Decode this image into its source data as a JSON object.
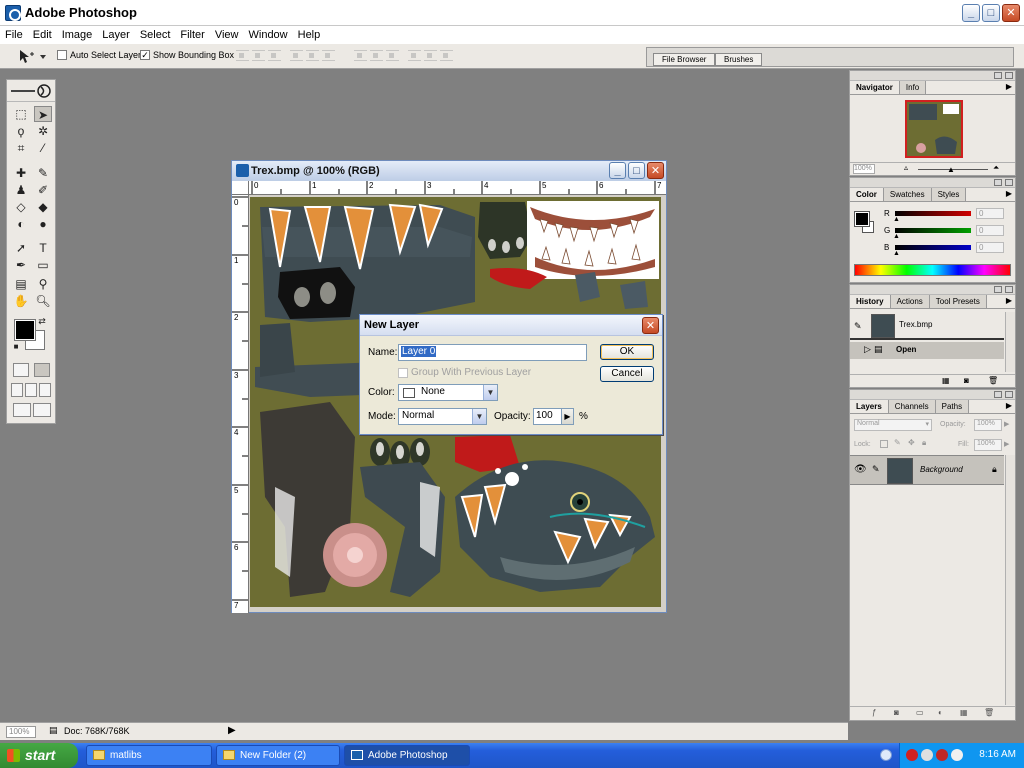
{
  "app": {
    "title": "Adobe Photoshop",
    "window_controls": {
      "minimize": "_",
      "maximize": "□",
      "close": "✕"
    }
  },
  "menu": [
    "File",
    "Edit",
    "Image",
    "Layer",
    "Select",
    "Filter",
    "View",
    "Window",
    "Help"
  ],
  "options_bar": {
    "auto_select_label": "Auto Select Layer",
    "auto_select_checked": false,
    "bounding_box_label": "Show Bounding Box",
    "bounding_box_checked": true,
    "palette_well_tabs": [
      "File Browser",
      "Brushes"
    ]
  },
  "document": {
    "title": "Trex.bmp @ 100% (RGB)",
    "ruler_h": [
      "0",
      "1",
      "2",
      "3",
      "4",
      "5",
      "6",
      "7"
    ],
    "ruler_v": [
      "0",
      "1",
      "2",
      "3",
      "4",
      "5",
      "6",
      "7"
    ]
  },
  "dialog": {
    "title": "New Layer",
    "name_label": "Name:",
    "name_value": "Layer 0",
    "group_label": "Group With Previous Layer",
    "color_label": "Color:",
    "color_value": "None",
    "mode_label": "Mode:",
    "mode_value": "Normal",
    "opacity_label": "Opacity:",
    "opacity_value": "100",
    "percent": "%",
    "ok": "OK",
    "cancel": "Cancel"
  },
  "navigator": {
    "tabs": [
      "Navigator",
      "Info"
    ],
    "zoom": "100%"
  },
  "color_palette": {
    "tabs": [
      "Color",
      "Swatches",
      "Styles"
    ],
    "channels": [
      {
        "label": "R",
        "value": "0",
        "color": "#d10000"
      },
      {
        "label": "G",
        "value": "0",
        "color": "#00a000"
      },
      {
        "label": "B",
        "value": "0",
        "color": "#0000c8"
      }
    ]
  },
  "history": {
    "tabs": [
      "History",
      "Actions",
      "Tool Presets"
    ],
    "snapshot": "Trex.bmp",
    "states": [
      "Open"
    ]
  },
  "layers": {
    "tabs": [
      "Layers",
      "Channels",
      "Paths"
    ],
    "blend_mode": "Normal",
    "opacity_label": "Opacity:",
    "opacity_value": "100%",
    "lock_label": "Lock:",
    "fill_label": "Fill:",
    "fill_value": "100%",
    "items": [
      "Background"
    ]
  },
  "status": {
    "zoom": "100%",
    "doc_info": "Doc: 768K/768K"
  },
  "taskbar": {
    "start": "start",
    "tasks": [
      "matlibs",
      "New Folder (2)",
      "Adobe Photoshop"
    ],
    "active_task": "Adobe Photoshop",
    "clock": "8:16 AM"
  }
}
